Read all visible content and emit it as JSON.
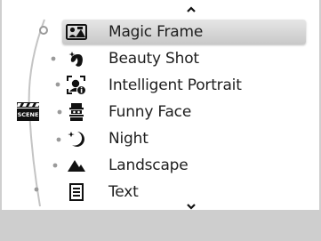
{
  "scroll": {
    "up_icon": "chevron-up-icon",
    "down_icon": "chevron-down-icon"
  },
  "mode_badge": {
    "label": "SCENE",
    "icon": "clapperboard-icon"
  },
  "menu": {
    "selected_index": 0,
    "items": [
      {
        "label": "Magic Frame",
        "icon": "magic-frame-icon"
      },
      {
        "label": "Beauty Shot",
        "icon": "beauty-shot-icon"
      },
      {
        "label": "Intelligent Portrait",
        "icon": "intelligent-portrait-icon"
      },
      {
        "label": "Funny Face",
        "icon": "funny-face-icon"
      },
      {
        "label": "Night",
        "icon": "night-icon"
      },
      {
        "label": "Landscape",
        "icon": "landscape-icon"
      },
      {
        "label": "Text",
        "icon": "text-icon"
      }
    ]
  },
  "colors": {
    "highlight": "#d6d6d6",
    "bottom_bar": "#cecece",
    "text": "#1e1e1e",
    "icon": "#111111"
  }
}
